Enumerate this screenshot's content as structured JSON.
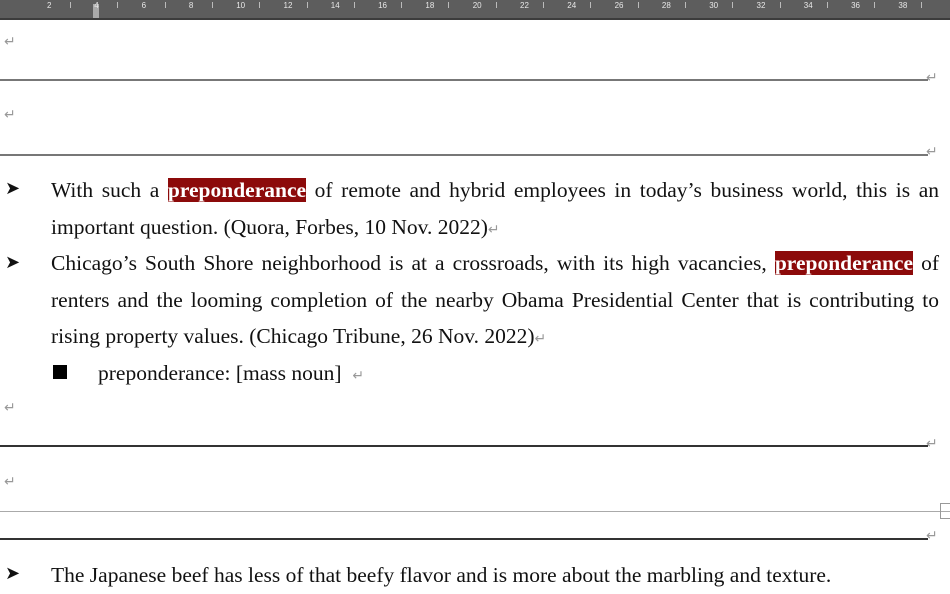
{
  "ruler": {
    "labels": [
      "2",
      "4",
      "6",
      "8",
      "10",
      "12",
      "14",
      "16",
      "18",
      "20",
      "22",
      "24",
      "26",
      "28",
      "30",
      "32",
      "34",
      "36",
      "38"
    ]
  },
  "colors": {
    "highlight": "#8c0a0a",
    "ruler": "#5d5d5d"
  },
  "icons": {
    "bullet": "arrowhead-bullet",
    "sub_bullet": "black-square",
    "paragraph_mark": "return-arrow"
  },
  "paragraph_mark": "↵",
  "bullets": [
    {
      "before": "With such a ",
      "highlight": "preponderance",
      "after": " of remote and hybrid employees in today’s business world, this is an important question. (Quora, Forbes, 10 Nov. 2022)"
    },
    {
      "before": "Chicago’s South Shore neighborhood is at a crossroads, with its high vacancies, ",
      "highlight": "preponderance",
      "after": " of renters and the looming completion of the nearby Obama Presidential Center that is contributing to rising property values. (Chicago Tribune, 26 Nov. 2022)"
    }
  ],
  "sub_item": "preponderance: [mass noun]",
  "last_bullet": "The Japanese beef has less of that beefy flavor and is more about the marbling and texture."
}
